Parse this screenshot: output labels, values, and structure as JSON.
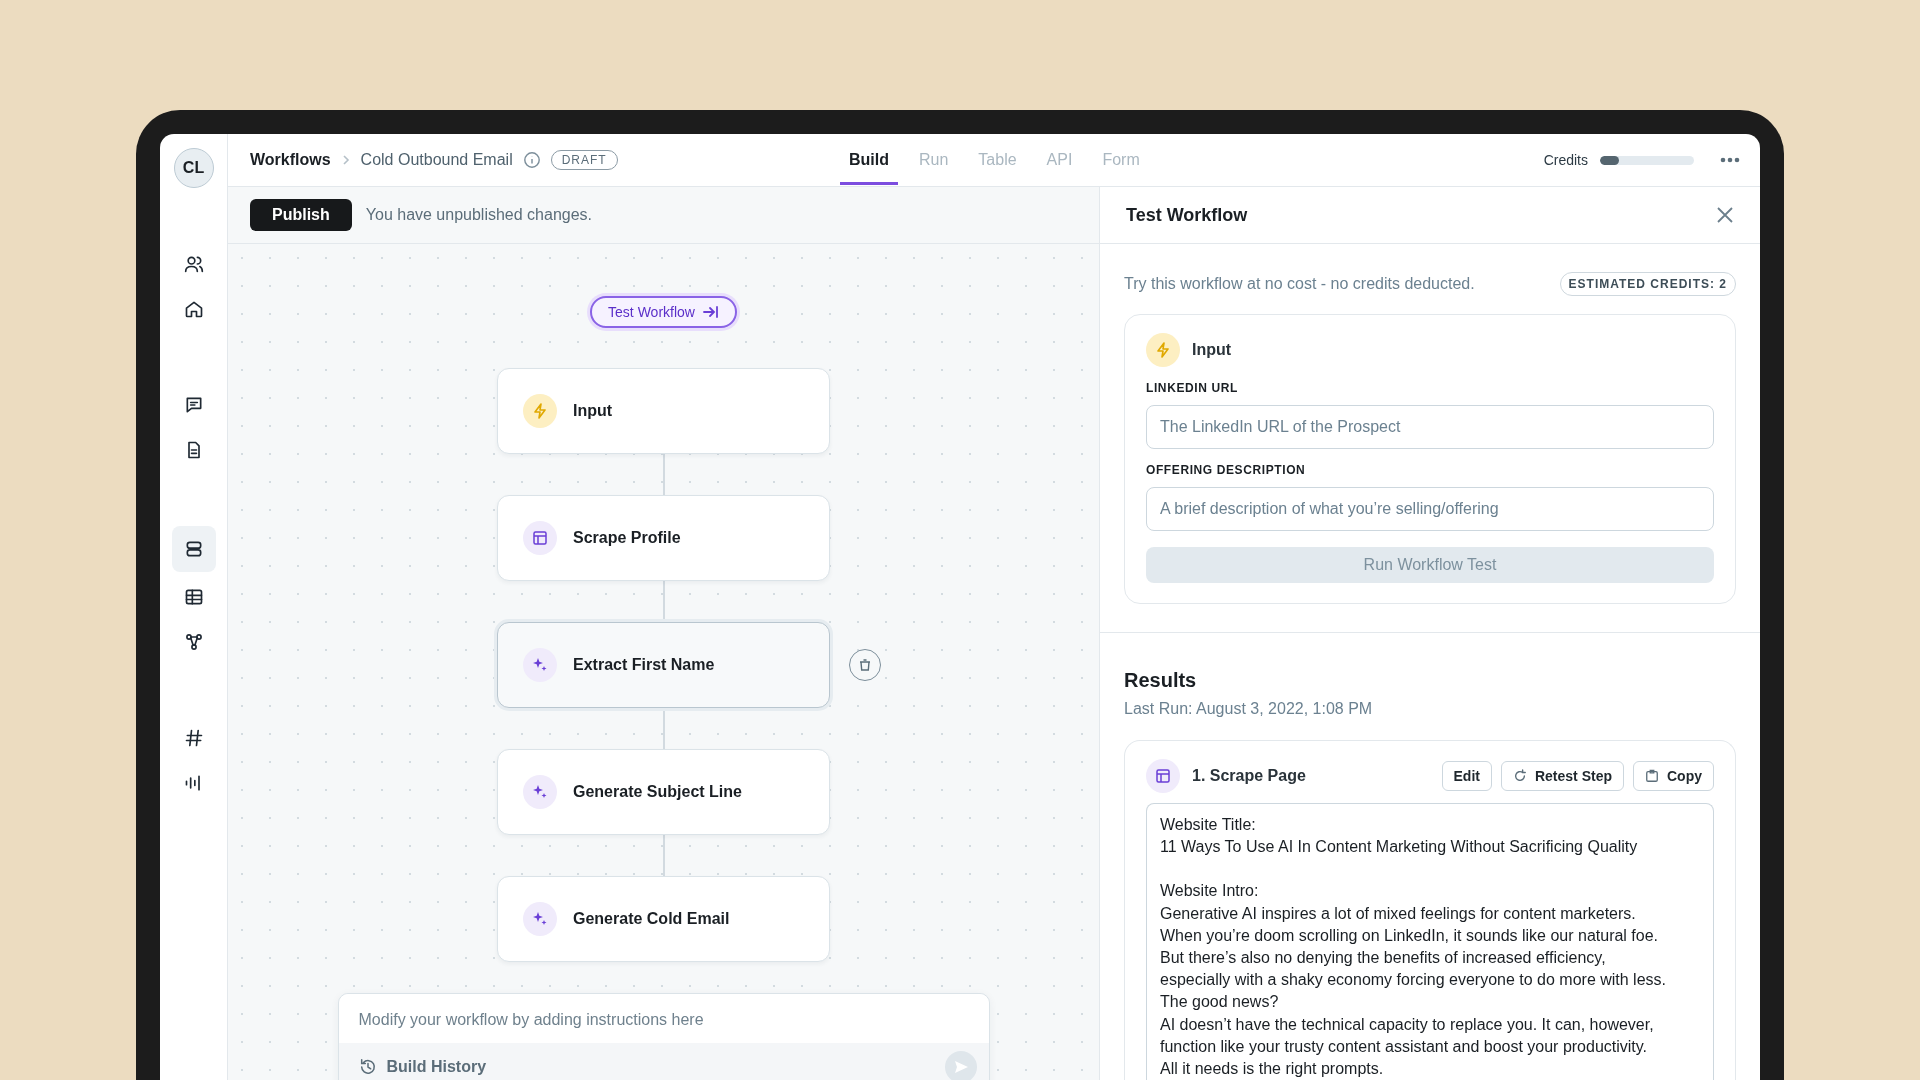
{
  "sidebar": {
    "avatar": "CL",
    "groups": [
      [
        {
          "kind": "people",
          "selected": false
        },
        {
          "kind": "home",
          "selected": false
        }
      ],
      [
        {
          "kind": "chat",
          "selected": false
        },
        {
          "kind": "document",
          "selected": false
        }
      ],
      [
        {
          "kind": "workflows",
          "selected": true
        },
        {
          "kind": "table",
          "selected": false
        },
        {
          "kind": "nodes",
          "selected": false
        }
      ],
      [
        {
          "kind": "hash",
          "selected": false
        },
        {
          "kind": "audio",
          "selected": false
        }
      ]
    ]
  },
  "breadcrumb": {
    "items": [
      "Workflows",
      "Cold Outbound Email"
    ],
    "badge": "DRAFT"
  },
  "tabs": [
    {
      "label": "Build",
      "selected": true
    },
    {
      "label": "Run",
      "selected": false
    },
    {
      "label": "Table",
      "selected": false
    },
    {
      "label": "API",
      "selected": false
    },
    {
      "label": "Form",
      "selected": false
    }
  ],
  "credits": {
    "label": "Credits",
    "level": 0.2
  },
  "publish_bar": {
    "button": "Publish",
    "message": "You have unpublished changes."
  },
  "canvas": {
    "test_button": "Test Workflow",
    "nodes": [
      {
        "title": "Input",
        "kind": "input",
        "selected": false
      },
      {
        "title": "Scrape Profile",
        "kind": "scrape",
        "selected": false
      },
      {
        "title": "Extract First Name",
        "kind": "ai",
        "selected": true
      },
      {
        "title": "Generate Subject Line",
        "kind": "ai",
        "selected": false
      },
      {
        "title": "Generate Cold Email",
        "kind": "ai",
        "selected": false
      }
    ],
    "prompt": {
      "placeholder": "Modify your workflow by adding instructions here",
      "history": "Build History"
    }
  },
  "test_panel": {
    "title": "Test Workflow",
    "note": "Try this workflow at no cost - no credits deducted.",
    "estimate": "ESTIMATED CREDITS: 2",
    "input_card": {
      "title": "Input",
      "fields": [
        {
          "label": "LINKEDIN URL",
          "placeholder": "The LinkedIn URL of the Prospect"
        },
        {
          "label": "OFFERING DESCRIPTION",
          "placeholder": "A brief description of what you’re selling/offering"
        }
      ],
      "run_button": {
        "label": "Run Workflow Test",
        "disabled": true
      }
    }
  },
  "results": {
    "title": "Results",
    "last_run": "Last Run: August 3, 2022, 1:08 PM",
    "steps": [
      {
        "title": "1. Scrape Page",
        "kind": "scrape",
        "actions": [
          {
            "label": "Edit",
            "kind": "plain"
          },
          {
            "label": "Retest Step",
            "kind": "retry"
          },
          {
            "label": "Copy",
            "kind": "copy"
          }
        ],
        "output": [
          {
            "label": "Website Title:",
            "lines": [
              "11 Ways To Use AI In Content Marketing Without Sacrificing Quality"
            ]
          },
          {
            "label": "Website Intro:",
            "lines": [
              "Generative AI inspires a lot of mixed feelings for content marketers.",
              "When you’re doom scrolling on LinkedIn, it sounds like our natural foe.",
              "But there’s also no denying the benefits of increased efficiency,",
              "especially with a shaky economy forcing everyone to do more with less.",
              "The good news?",
              "AI doesn’t have the technical capacity to replace you. It can, however,",
              "function like your trusty content assistant and boost your productivity.",
              "All it needs is the right prompts."
            ]
          }
        ]
      }
    ]
  }
}
